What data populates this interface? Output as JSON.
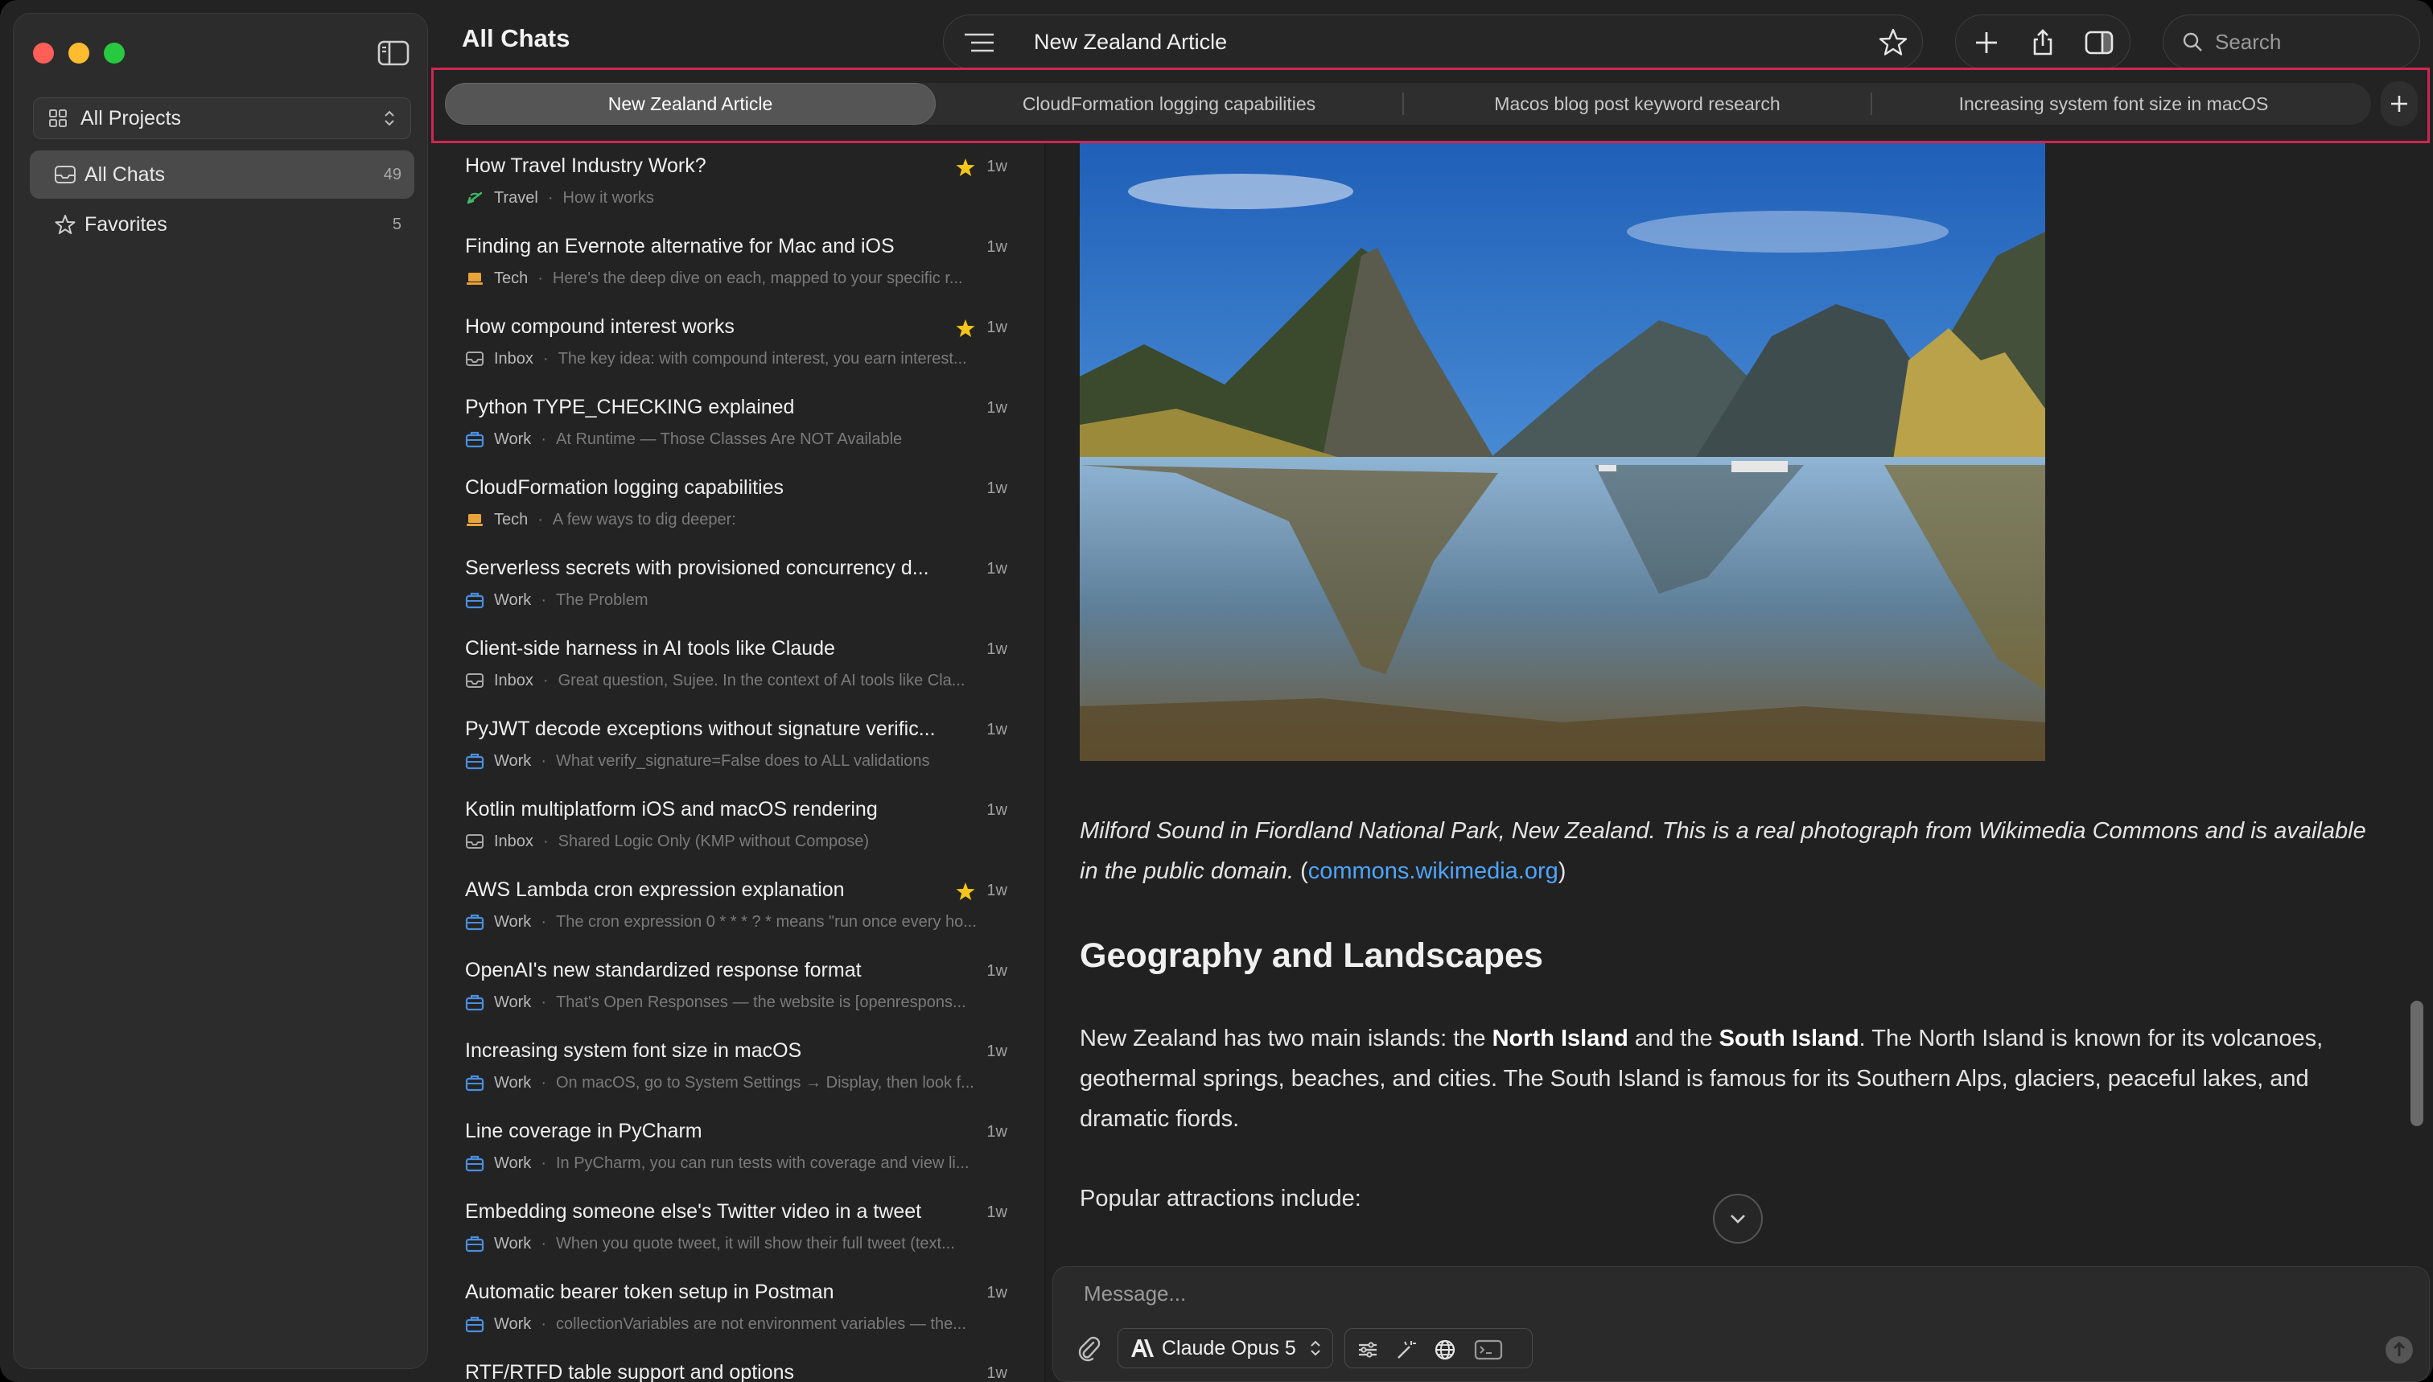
{
  "sidebar": {
    "project_select": "All Projects",
    "items": [
      {
        "label": "All Chats",
        "count": "49"
      },
      {
        "label": "Favorites",
        "count": "5"
      }
    ]
  },
  "header": {
    "title": "All Chats",
    "chat_title": "New Zealand Article",
    "search_placeholder": "Search"
  },
  "tabs": [
    {
      "label": "New Zealand Article",
      "active": true
    },
    {
      "label": "CloudFormation logging capabilities",
      "active": false
    },
    {
      "label": "Macos blog post keyword research",
      "active": false
    },
    {
      "label": "Increasing system font size in macOS",
      "active": false
    }
  ],
  "chats": [
    {
      "title": "How Travel Industry Work?",
      "folder": "Travel",
      "preview": "How it works",
      "time": "1w",
      "starred": true,
      "icon": "travel-icon"
    },
    {
      "title": "Finding an Evernote alternative for Mac and iOS",
      "folder": "Tech",
      "preview": "Here's the deep dive on each, mapped to your specific r...",
      "time": "1w",
      "starred": false,
      "icon": "laptop-icon"
    },
    {
      "title": "How compound interest works",
      "folder": "Inbox",
      "preview": "The key idea: with compound interest, you earn interest...",
      "time": "1w",
      "starred": true,
      "icon": "inbox-icon"
    },
    {
      "title": "Python TYPE_CHECKING explained",
      "folder": "Work",
      "preview": "At Runtime — Those Classes Are NOT Available",
      "time": "1w",
      "starred": false,
      "icon": "briefcase-icon"
    },
    {
      "title": "CloudFormation logging capabilities",
      "folder": "Tech",
      "preview": "A few ways to dig deeper:",
      "time": "1w",
      "starred": false,
      "icon": "laptop-icon"
    },
    {
      "title": "Serverless secrets with provisioned concurrency d...",
      "folder": "Work",
      "preview": "The Problem",
      "time": "1w",
      "starred": false,
      "icon": "briefcase-icon"
    },
    {
      "title": "Client-side harness in AI tools like Claude",
      "folder": "Inbox",
      "preview": "Great question, Sujee. In the context of AI tools like Cla...",
      "time": "1w",
      "starred": false,
      "icon": "inbox-icon"
    },
    {
      "title": "PyJWT decode exceptions without signature verific...",
      "folder": "Work",
      "preview": "What verify_signature=False does to ALL validations",
      "time": "1w",
      "starred": false,
      "icon": "briefcase-icon"
    },
    {
      "title": "Kotlin multiplatform iOS and macOS rendering",
      "folder": "Inbox",
      "preview": "Shared Logic Only (KMP without Compose)",
      "time": "1w",
      "starred": false,
      "icon": "inbox-icon"
    },
    {
      "title": "AWS Lambda cron expression explanation",
      "folder": "Work",
      "preview": "The cron expression 0 * * * ? * means \"run once every ho...",
      "time": "1w",
      "starred": true,
      "icon": "briefcase-icon"
    },
    {
      "title": "OpenAI's new standardized response format",
      "folder": "Work",
      "preview": "That's Open Responses — the website is [openrespons...",
      "time": "1w",
      "starred": false,
      "icon": "briefcase-icon"
    },
    {
      "title": "Increasing system font size in macOS",
      "folder": "Work",
      "preview": "On macOS, go to System Settings → Display, then look f...",
      "time": "1w",
      "starred": false,
      "icon": "briefcase-icon"
    },
    {
      "title": "Line coverage in PyCharm",
      "folder": "Work",
      "preview": "In PyCharm, you can run tests with coverage and view li...",
      "time": "1w",
      "starred": false,
      "icon": "briefcase-icon"
    },
    {
      "title": "Embedding someone else's Twitter video in a tweet",
      "folder": "Work",
      "preview": "When you quote tweet, it will show their full tweet (text...",
      "time": "1w",
      "starred": false,
      "icon": "briefcase-icon"
    },
    {
      "title": "Automatic bearer token setup in Postman",
      "folder": "Work",
      "preview": "collectionVariables are not environment variables — the...",
      "time": "1w",
      "starred": false,
      "icon": "briefcase-icon"
    },
    {
      "title": "RTF/RTFD table support and options",
      "folder": "",
      "preview": "",
      "time": "1w",
      "starred": false,
      "icon": ""
    }
  ],
  "article": {
    "caption_italic": "Milford Sound in Fiordland National Park, New Zealand. This is a real photograph from Wikimedia Commons and is available in the public domain.",
    "caption_link": "commons.wikimedia.org",
    "heading": "Geography and Landscapes",
    "para_1": "New Zealand has two main islands: the ",
    "para_north": "North Island",
    "para_2": " and the ",
    "para_south": "South Island",
    "para_3": ". The North Island is known for its volcanoes, geothermal springs, beaches, and cities. The South Island is famous for its Southern Alps, glaciers, peaceful lakes, and dramatic fiords.",
    "para_attractions": "Popular attractions include:"
  },
  "composer": {
    "placeholder": "Message...",
    "model": "Claude Opus 5"
  },
  "colors": {
    "accent_link": "#4ea5ff",
    "star": "#f5c518",
    "tab_highlight": "#d0264f",
    "travel": "#3fb96a",
    "tech": "#e8a33a",
    "work": "#4a8fe0"
  }
}
